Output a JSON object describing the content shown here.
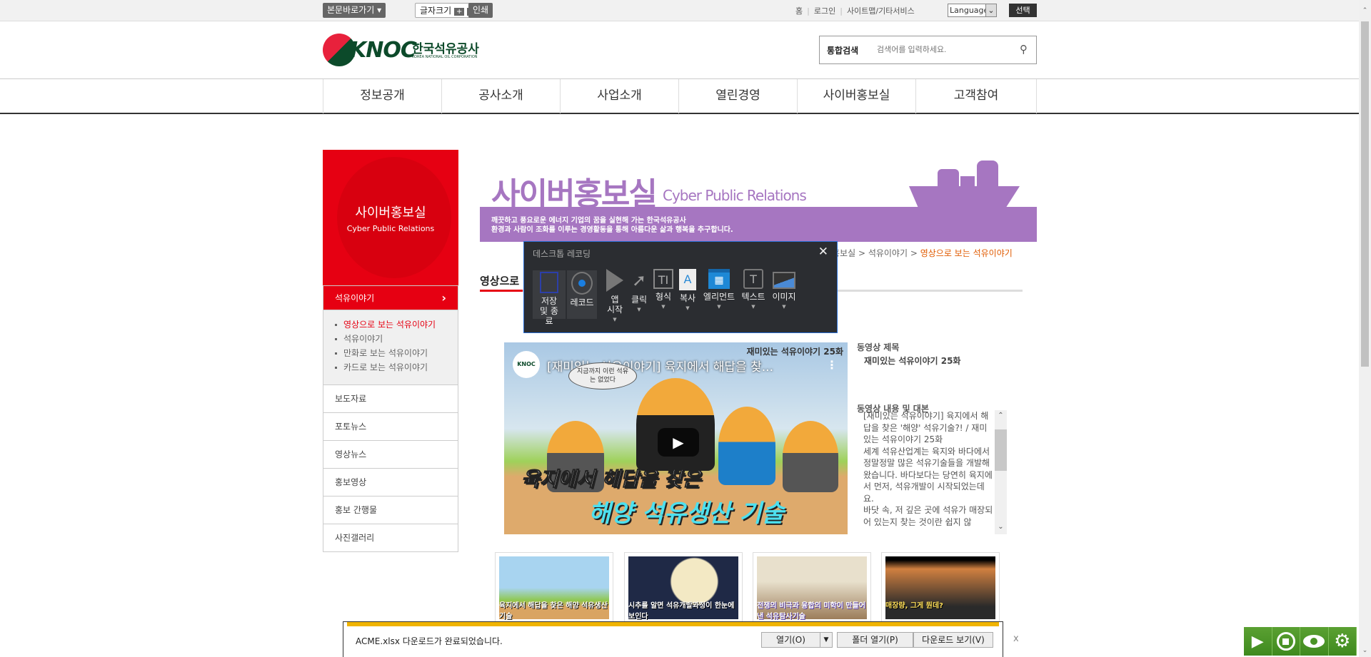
{
  "topbar": {
    "skip": "본문바로가기",
    "fontsize": "글자크기",
    "plus": "+",
    "minus": "−",
    "print": "인쇄",
    "links": [
      "홈",
      "로그인",
      "사이트맵/기타서비스"
    ],
    "language": "Language",
    "select": "선택"
  },
  "header": {
    "logo_text": "KNOC",
    "logo_ko": "한국석유공사",
    "logo_en": "KOREA NATIONAL OIL CORPORATION",
    "search_label": "통합검색",
    "search_placeholder": "검색어를 입력하세요."
  },
  "nav": [
    "정보공개",
    "공사소개",
    "사업소개",
    "열린경영",
    "사이버홍보실",
    "고객참여"
  ],
  "sidebar": {
    "title": "사이버홍보실",
    "subtitle": "Cyber Public Relations",
    "active": "석유이야기",
    "subitems": [
      "영상으로 보는 석유이야기",
      "석유이야기",
      "만화로 보는 석유이야기",
      "카드로 보는 석유이야기"
    ],
    "items": [
      "보도자료",
      "포토뉴스",
      "영상뉴스",
      "홍보영상",
      "홍보 간행물",
      "사진갤러리"
    ]
  },
  "banner": {
    "title": "사이버홍보실",
    "title_en": "Cyber Public Relations",
    "line1": "깨끗하고 풍요로운 에너지 기업의 꿈을 실현해 가는 한국석유공사",
    "line2": "환경과 사람이 조화를 이루는 경영활동을 통해 아름다운 삶과 행복을 추구합니다."
  },
  "breadcrumb": {
    "items": [
      "홍보실",
      "석유이야기"
    ],
    "current": "영상으로 보는 석유이야기"
  },
  "page_heading": "영상으로",
  "recorder": {
    "title": "데스크톱 레코딩",
    "tools": [
      "저장 및 종료",
      "레코드",
      "앱 시작",
      "클릭",
      "형식",
      "복사",
      "엘리먼트",
      "텍스트",
      "이미지"
    ]
  },
  "video": {
    "title": "[재미있는 석유이야기] 육지에서 해답을 찾...",
    "badge": "재미있는 석유이야기 25화",
    "bubble": "지금까지 이런 석유는 없었다",
    "caption1": "육지에서 해답을 찾은",
    "caption2": "해양 석유생산 기술"
  },
  "info": {
    "title_label": "동영상 제목",
    "title_value": "재미있는 석유이야기 25화",
    "desc_label": "동영상 내용 및 대본",
    "desc": "[재미있는 석유이야기] 육지에서 해답을 찾은 '해양' 석유기술?! / 재미있는 석유이야기 25화\n세계 석유산업계는 육지와 바다에서 정말정말 많은 석유기술들을 개발해 왔습니다. 바다보다는 당연히 육지에서 먼저, 석유개발이 시작되었는데요.\n바닷 속, 저 깊은 곳에 석유가 매장되어 있는지 찾는 것이란 쉽지 않"
  },
  "thumbs": [
    "육지에서 해답을 찾은 해양 석유생산 기술",
    "시추를 알면 석유개발과정이 한눈에 보인다",
    "전쟁의 비극과 융합의 미학이 만들어낸 석유탐사기술",
    "매장량, 그게 뭔데?"
  ],
  "download": {
    "message": "ACME.xlsx 다운로드가 완료되었습니다.",
    "open": "열기(O)",
    "open_folder": "폴더 열기(P)",
    "view": "다운로드 보기(V)",
    "close": "x"
  },
  "colors": {
    "red": "#e60012",
    "purple": "#a676c1",
    "accent_orange": "#e05a00",
    "green": "#4a9426"
  }
}
